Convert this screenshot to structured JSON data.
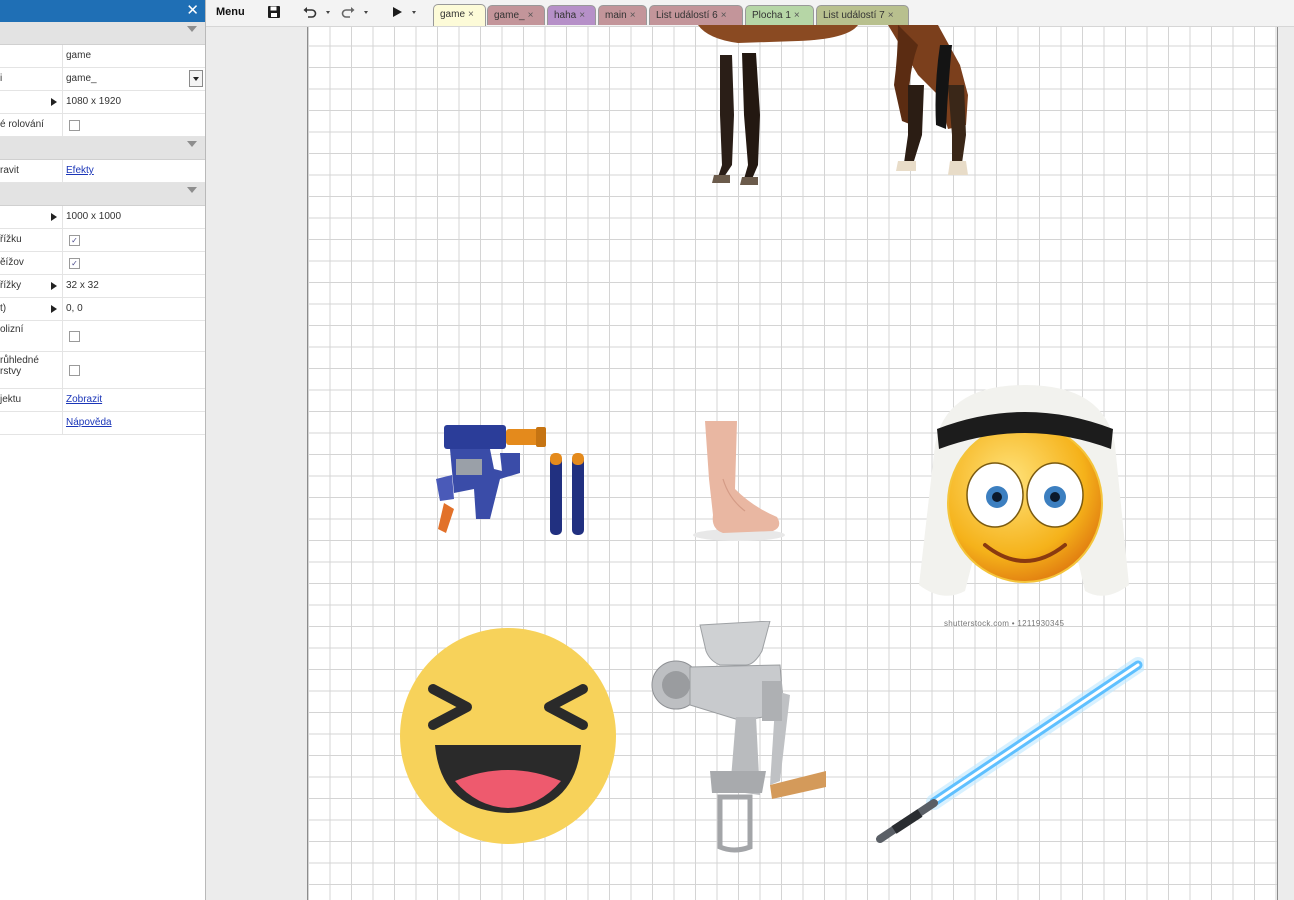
{
  "props": {
    "rows": [
      {
        "label": "",
        "value": "game"
      },
      {
        "label": "i",
        "value": "game_"
      },
      {
        "label": "",
        "value": "1080 x 1920"
      },
      {
        "label": "é rolování",
        "value": ""
      },
      {
        "label": "ravit",
        "link": "Efekty"
      },
      {
        "label": "",
        "value": "1000 x 1000"
      },
      {
        "label": "řížku",
        "value": ""
      },
      {
        "label": "ěížov",
        "value": ""
      },
      {
        "label": "řížky",
        "value": "32 x 32"
      },
      {
        "label": "t)",
        "value": "0, 0"
      },
      {
        "label": "olizní",
        "value": ""
      },
      {
        "label": "růhledné rstvy",
        "value": ""
      },
      {
        "label": "jektu",
        "link": "Zobrazit"
      },
      {
        "label": "",
        "link": "Nápověda"
      }
    ]
  },
  "toolbar": {
    "menu_label": "Menu",
    "icons": [
      "save-icon",
      "undo-icon",
      "redo-icon",
      "play-icon"
    ]
  },
  "tabs": [
    {
      "label": "game",
      "color": "#fdfbd8"
    },
    {
      "label": "game_",
      "color": "#c3959a"
    },
    {
      "label": "haha",
      "color": "#b690c8"
    },
    {
      "label": "main",
      "color": "#c3959a"
    },
    {
      "label": "List událostí 6",
      "color": "#c3959a"
    },
    {
      "label": "Plocha 1",
      "color": "#b6d6a6"
    },
    {
      "label": "List událostí 7",
      "color": "#b8c08e"
    }
  ],
  "canvas": {
    "watermark": "shutterstock.com • 1211930345",
    "objects": [
      "horse",
      "nerf-blaster",
      "foot",
      "arab-emoji",
      "laughing-emoji",
      "meat-grinder",
      "lightsaber"
    ]
  }
}
